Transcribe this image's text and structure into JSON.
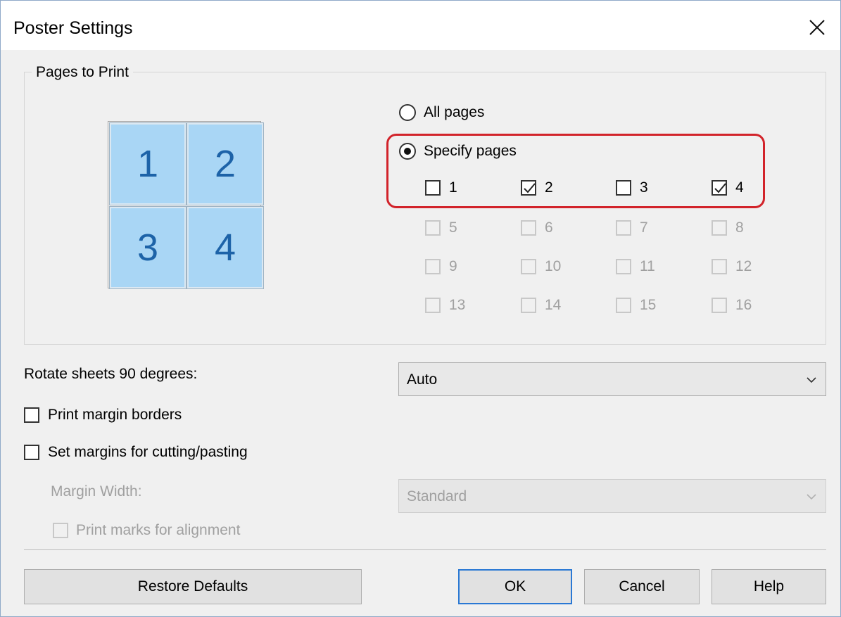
{
  "window": {
    "title": "Poster Settings"
  },
  "pages_group": {
    "title": "Pages to Print",
    "preview_tiles": [
      "1",
      "2",
      "3",
      "4"
    ],
    "all_pages_label": "All pages",
    "specify_pages_label": "Specify pages",
    "selected_option": "Specify pages",
    "pages": [
      {
        "label": "1",
        "checked": false,
        "enabled": true
      },
      {
        "label": "2",
        "checked": true,
        "enabled": true
      },
      {
        "label": "3",
        "checked": false,
        "enabled": true
      },
      {
        "label": "4",
        "checked": true,
        "enabled": true
      },
      {
        "label": "5",
        "checked": false,
        "enabled": false
      },
      {
        "label": "6",
        "checked": false,
        "enabled": false
      },
      {
        "label": "7",
        "checked": false,
        "enabled": false
      },
      {
        "label": "8",
        "checked": false,
        "enabled": false
      },
      {
        "label": "9",
        "checked": false,
        "enabled": false
      },
      {
        "label": "10",
        "checked": false,
        "enabled": false
      },
      {
        "label": "11",
        "checked": false,
        "enabled": false
      },
      {
        "label": "12",
        "checked": false,
        "enabled": false
      },
      {
        "label": "13",
        "checked": false,
        "enabled": false
      },
      {
        "label": "14",
        "checked": false,
        "enabled": false
      },
      {
        "label": "15",
        "checked": false,
        "enabled": false
      },
      {
        "label": "16",
        "checked": false,
        "enabled": false
      }
    ]
  },
  "rotate": {
    "label": "Rotate sheets 90 degrees:",
    "value": "Auto"
  },
  "print_margin_borders": {
    "label": "Print margin borders",
    "checked": false
  },
  "set_margins": {
    "label": "Set margins for cutting/pasting",
    "checked": false
  },
  "margin_width": {
    "label": "Margin Width:",
    "value": "Standard",
    "enabled": false
  },
  "print_marks": {
    "label": "Print marks for alignment",
    "checked": false,
    "enabled": false
  },
  "buttons": {
    "restore_defaults": "Restore Defaults",
    "ok": "OK",
    "cancel": "Cancel",
    "help": "Help"
  },
  "colors": {
    "highlight": "#d2232a",
    "tile_fill": "#a9d6f5",
    "tile_text": "#1d63a8",
    "default_button_border": "#2a78d4"
  }
}
